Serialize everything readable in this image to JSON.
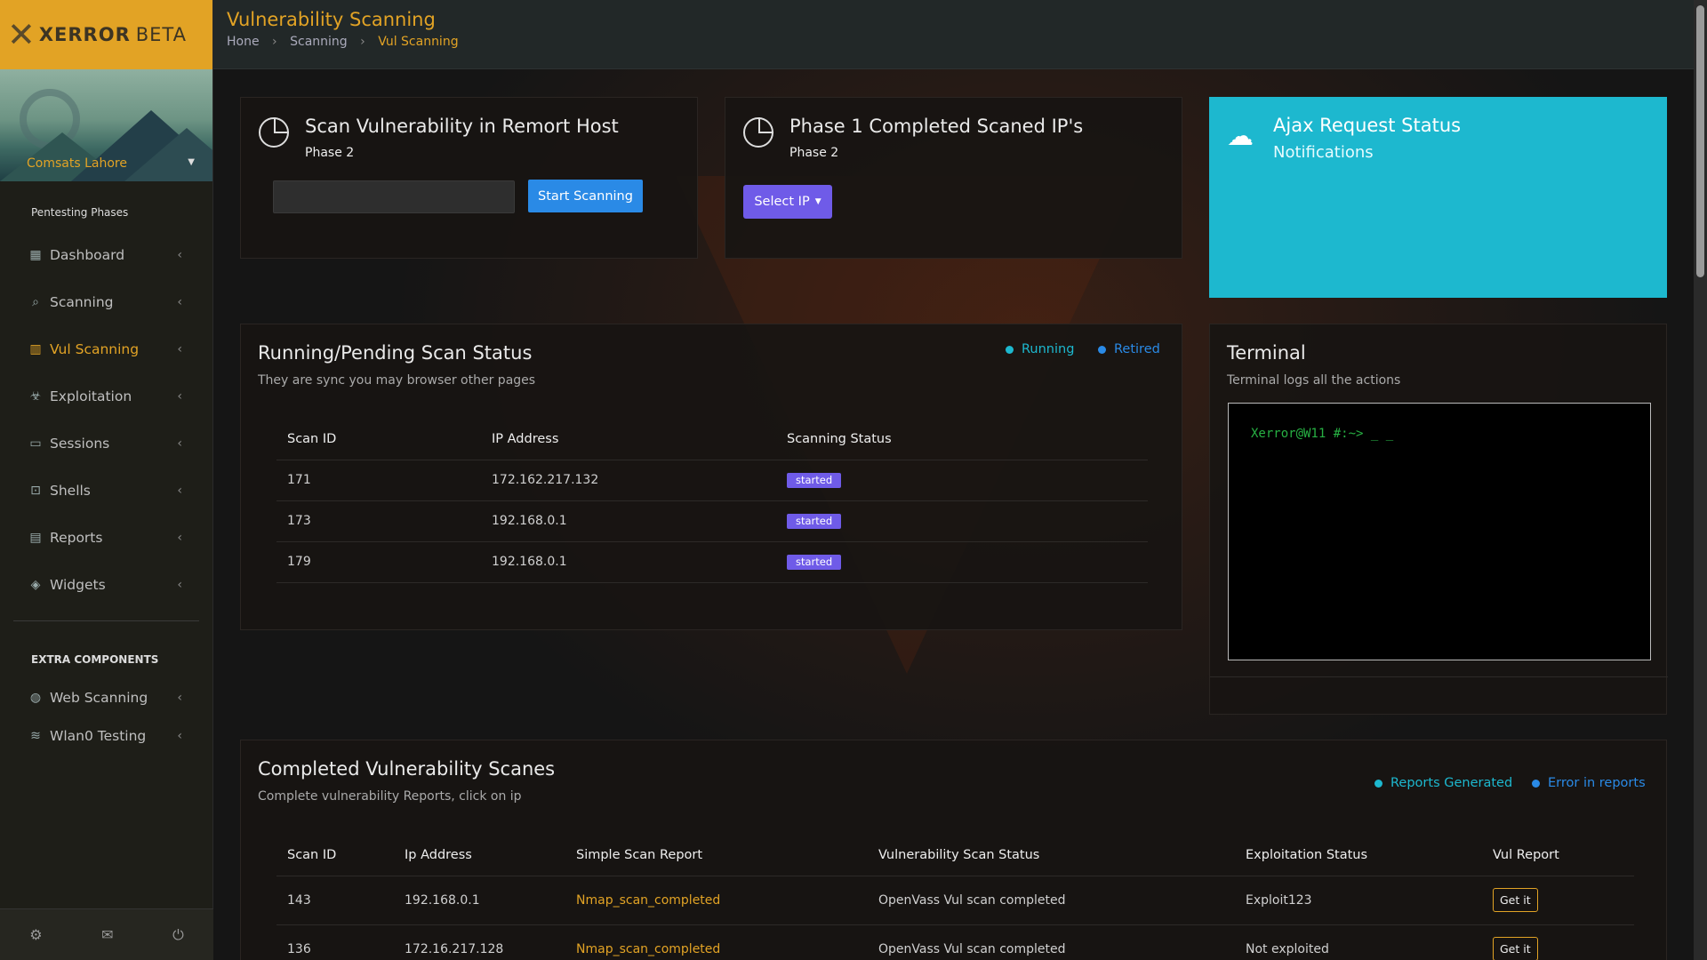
{
  "brand": {
    "name": "XERROR",
    "suffix": "BETA"
  },
  "user": {
    "name": "Comsats Lahore"
  },
  "nav": {
    "section1": "Pentesting Phases",
    "items": [
      {
        "label": "Dashboard",
        "icon": "dashboard-icon"
      },
      {
        "label": "Scanning",
        "icon": "search-icon"
      },
      {
        "label": "Vul Scanning",
        "icon": "barcode-icon"
      },
      {
        "label": "Exploitation",
        "icon": "biohazard-icon"
      },
      {
        "label": "Sessions",
        "icon": "laptop-icon"
      },
      {
        "label": "Shells",
        "icon": "terminal-icon"
      },
      {
        "label": "Reports",
        "icon": "file-icon"
      },
      {
        "label": "Widgets",
        "icon": "widgets-icon"
      }
    ],
    "section2": "EXTRA COMPONENTS",
    "extra": [
      {
        "label": "Web Scanning",
        "icon": "globe-icon"
      },
      {
        "label": "Wlan0 Testing",
        "icon": "wifi-icon"
      }
    ]
  },
  "header": {
    "title": "Vulnerability Scanning",
    "breadcrumb": [
      "Hone",
      "Scanning",
      "Vul Scanning"
    ]
  },
  "scan_card": {
    "title": "Scan Vulnerability in Remort Host",
    "subtitle": "Phase 2",
    "input_placeholder": "",
    "button": "Start Scanning"
  },
  "phase1_card": {
    "title": "Phase 1 Completed Scaned IP's",
    "subtitle": "Phase 2",
    "button": "Select IP"
  },
  "ajax_card": {
    "title": "Ajax Request Status",
    "subtitle": "Notifications"
  },
  "running": {
    "title": "Running/Pending Scan Status",
    "subtitle": "They are sync you may browser other pages",
    "legend": [
      {
        "label": "Running",
        "color": "#1db8cf"
      },
      {
        "label": "Retired",
        "color": "#2a8ae6"
      }
    ],
    "columns": [
      "Scan ID",
      "IP Address",
      "Scanning Status"
    ],
    "rows": [
      {
        "id": "171",
        "ip": "172.162.217.132",
        "status": "started"
      },
      {
        "id": "173",
        "ip": "192.168.0.1",
        "status": "started"
      },
      {
        "id": "179",
        "ip": "192.168.0.1",
        "status": "started"
      }
    ]
  },
  "terminal": {
    "title": "Terminal",
    "subtitle": "Terminal logs all the actions",
    "prompt": "Xerror@W11 #:~> _ _"
  },
  "completed": {
    "title": "Completed Vulnerability Scanes",
    "subtitle": "Complete vulnerability Reports, click on ip",
    "legend": [
      {
        "label": "Reports Generated",
        "color": "#1db8cf"
      },
      {
        "label": "Error in reports",
        "color": "#2a8ae6"
      }
    ],
    "columns": [
      "Scan ID",
      "Ip Address",
      "Simple Scan Report",
      "Vulnerability Scan Status",
      "Exploitation Status",
      "Vul Report"
    ],
    "rows": [
      {
        "id": "143",
        "ip": "192.168.0.1",
        "report": "Nmap_scan_completed",
        "vul": "OpenVass Vul scan completed",
        "exploit": "Exploit123",
        "action": "Get it"
      },
      {
        "id": "136",
        "ip": "172.16.217.128",
        "report": "Nmap_scan_completed",
        "vul": "OpenVass Vul scan completed",
        "exploit": "Not exploited",
        "action": "Get it"
      }
    ]
  },
  "colors": {
    "accent": "#e2a325",
    "cyan": "#1db8cf",
    "blue": "#2a8ae6",
    "purple": "#6f5be8"
  }
}
